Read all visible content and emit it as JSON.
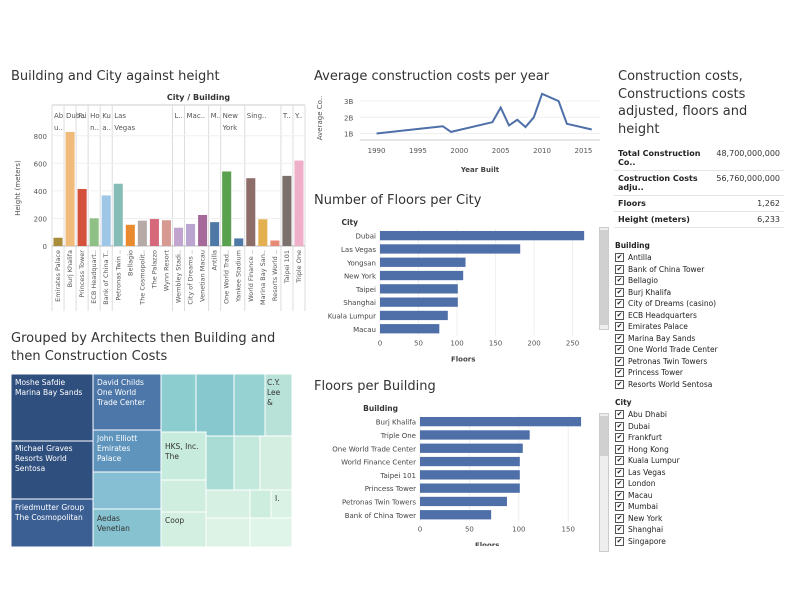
{
  "titles": {
    "building_city": "Building and City against height",
    "avg_cost": "Average construction costs per year",
    "summary": "Construction costs, Constructions costs adjusted, floors and height",
    "architects": "Grouped by Architects then Building and then Construction Costs",
    "floors_city": "Number of Floors per City",
    "floors_building": "Floors per Building"
  },
  "summary_rows": [
    {
      "label": "Total Construction Co..",
      "value": "48,700,000,000"
    },
    {
      "label": "Costruction Costs adju..",
      "value": "56,760,000,000"
    },
    {
      "label": "Floors",
      "value": "1,262"
    },
    {
      "label": "Height (meters)",
      "value": "6,233"
    }
  ],
  "filters": {
    "building_title": "Building",
    "buildings": [
      "Antilla",
      "Bank of China Tower",
      "Bellagio",
      "Burj Khalifa",
      "City of Dreams (casino)",
      "ECB Headquarters",
      "Emirates Palace",
      "Marina Bay Sands",
      "One World Trade Center",
      "Petronas Twin Towers",
      "Princess Tower",
      "Resorts World Sentosa"
    ],
    "city_title": "City",
    "cities": [
      "Abu Dhabi",
      "Dubai",
      "Frankfurt",
      "Hong Kong",
      "Kuala Lumpur",
      "Las Vegas",
      "London",
      "Macau",
      "Mumbai",
      "New York",
      "Shanghai",
      "Singapore"
    ],
    "check_mark": "✔"
  },
  "treemap_labels": [
    {
      "lines": [
        "Moshe Safdie",
        "Marina Bay Sands"
      ]
    },
    {
      "lines": [
        "David Childs",
        "One World",
        "Trade Center"
      ]
    },
    {
      "lines": [
        "C.Y.",
        "Lee",
        "&"
      ]
    },
    {
      "lines": [
        "John Elliott",
        "Emirates",
        "Palace"
      ]
    },
    {
      "lines": [
        "Michael Graves",
        "Resorts World",
        "Sentosa"
      ]
    },
    {
      "lines": [
        "HKS, Inc.",
        "The"
      ]
    },
    {
      "lines": [
        "I."
      ]
    },
    {
      "lines": [
        "Friedmutter Group",
        "The Cosmopolitan"
      ]
    },
    {
      "lines": [
        "Aedas",
        "Venetian"
      ]
    },
    {
      "lines": [
        "Coop"
      ]
    }
  ],
  "chart_data": [
    {
      "type": "bar",
      "title": "Building and City against height",
      "header": "City / Building",
      "ylabel": "Height (meters)",
      "ylim": [
        0,
        900
      ],
      "yticks": [
        0,
        200,
        400,
        600,
        800
      ],
      "groups": [
        {
          "city": "Ab u..",
          "buildings": [
            "Emirates Palace"
          ]
        },
        {
          "city": "Dubai",
          "buildings": [
            "Burj Khalifa"
          ]
        },
        {
          "city": "F..",
          "buildings": [
            "Princess Tower"
          ]
        },
        {
          "city": "Ho n..",
          "buildings": [
            "ECB Headquart.."
          ]
        },
        {
          "city": "Ku a..",
          "buildings": [
            "Bank of China T.."
          ]
        },
        {
          "city": "Las Vegas",
          "buildings": [
            "Petronas Twin ..",
            "Bellagio",
            "The Cosmopolit..",
            "The Palazzo",
            "Wynn Resort"
          ]
        },
        {
          "city": "L..",
          "buildings": [
            "Wembley Stadi.."
          ]
        },
        {
          "city": "Mac..",
          "buildings": [
            "City of Dreams ..",
            "Venetian Macau"
          ]
        },
        {
          "city": "M..",
          "buildings": [
            "Antilla"
          ]
        },
        {
          "city": "New York",
          "buildings": [
            "One World Trad..",
            "Yankee Stadium"
          ]
        },
        {
          "city": "Sing..",
          "buildings": [
            "World Finance ..",
            "Marina Bay San..",
            "Resorts World .."
          ]
        },
        {
          "city": "T..",
          "buildings": [
            "Taipei 101"
          ]
        },
        {
          "city": "Y..",
          "buildings": [
            "Triple One"
          ]
        }
      ],
      "categories": [
        "Emirates Palace",
        "Burj Khalifa",
        "Princess Tower",
        "ECB Headquart..",
        "Bank of China T..",
        "Petronas Twin ..",
        "Bellagio",
        "The Cosmopolit..",
        "The Palazzo",
        "Wynn Resort",
        "Wembley Stadi..",
        "City of Dreams ..",
        "Venetian Macau",
        "Antilla",
        "One World Trad..",
        "Yankee Stadium",
        "World Finance ..",
        "Marina Bay San..",
        "Resorts World ..",
        "Taipei 101",
        "Triple One"
      ],
      "values": [
        60,
        828,
        414,
        201,
        367,
        452,
        154,
        184,
        196,
        187,
        133,
        160,
        225,
        173,
        541,
        55,
        492,
        194,
        40,
        509,
        620
      ],
      "colors": [
        "#a98d3b",
        "#f1bb7b",
        "#d4513b",
        "#8fc186",
        "#9ec6e6",
        "#86bcb6",
        "#e98a2e",
        "#b6aaa6",
        "#d6697a",
        "#d69a92",
        "#c2a5cf",
        "#b9a5cf",
        "#a5699a",
        "#4e79a7",
        "#59a14f",
        "#4e79a7",
        "#8c6d68",
        "#e3b04f",
        "#e88a78",
        "#7b706b",
        "#f0afc8"
      ]
    },
    {
      "type": "line",
      "title": "Average construction costs per year",
      "xlabel": "Year Built",
      "ylabel": "Average Co..",
      "xlim": [
        1988,
        2017
      ],
      "ylim": [
        0.6,
        3.5
      ],
      "xticks": [
        1990,
        1995,
        2000,
        2005,
        2010,
        2015
      ],
      "yticks": [
        1,
        2,
        3
      ],
      "ytick_labels": [
        "1B",
        "2B",
        "3B"
      ],
      "x": [
        1990,
        1998,
        1999,
        2004,
        2005,
        2006,
        2007,
        2008,
        2009,
        2010,
        2012,
        2013,
        2016
      ],
      "y": [
        1.0,
        1.45,
        1.1,
        1.7,
        2.6,
        1.5,
        1.85,
        1.4,
        2.0,
        3.45,
        3.0,
        1.6,
        1.25
      ]
    },
    {
      "type": "bar",
      "title": "Number of Floors per City",
      "ylabel": "City",
      "xlabel": "Floors",
      "xlim": [
        0,
        270
      ],
      "xticks": [
        0,
        50,
        100,
        150,
        200,
        250
      ],
      "categories": [
        "Dubai",
        "Las Vegas",
        "Yongsan",
        "New York",
        "Taipei",
        "Shanghai",
        "Kuala Lumpur",
        "Macau"
      ],
      "values": [
        265,
        182,
        111,
        108,
        101,
        101,
        88,
        77
      ],
      "color": "#4e6fa8"
    },
    {
      "type": "bar",
      "title": "Floors per Building",
      "ylabel": "Building",
      "xlabel": "Floors",
      "xlim": [
        0,
        170
      ],
      "xticks": [
        0,
        50,
        100,
        150
      ],
      "categories": [
        "Burj Khalifa",
        "Triple One",
        "One World Trade Center",
        "World Finance Center",
        "Taipei 101",
        "Princess Tower",
        "Petronas Twin Towers",
        "Bank of China Tower"
      ],
      "values": [
        163,
        111,
        104,
        101,
        101,
        101,
        88,
        72
      ],
      "color": "#4e6fa8"
    }
  ]
}
